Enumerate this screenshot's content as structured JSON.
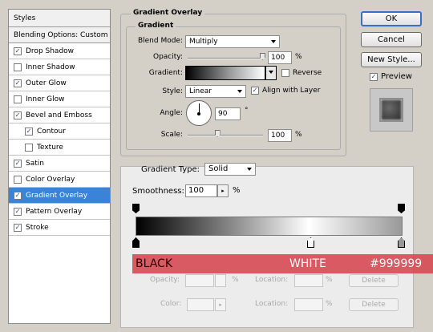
{
  "styles_panel": {
    "header": "Styles",
    "blending_options": "Blending Options: Custom",
    "items": [
      {
        "label": "Drop Shadow",
        "checked": true,
        "indent": false,
        "selected": false
      },
      {
        "label": "Inner Shadow",
        "checked": false,
        "indent": false,
        "selected": false
      },
      {
        "label": "Outer Glow",
        "checked": true,
        "indent": false,
        "selected": false
      },
      {
        "label": "Inner Glow",
        "checked": false,
        "indent": false,
        "selected": false
      },
      {
        "label": "Bevel and Emboss",
        "checked": true,
        "indent": false,
        "selected": false
      },
      {
        "label": "Contour",
        "checked": true,
        "indent": true,
        "selected": false
      },
      {
        "label": "Texture",
        "checked": false,
        "indent": true,
        "selected": false
      },
      {
        "label": "Satin",
        "checked": true,
        "indent": false,
        "selected": false
      },
      {
        "label": "Color Overlay",
        "checked": false,
        "indent": false,
        "selected": false
      },
      {
        "label": "Gradient Overlay",
        "checked": true,
        "indent": false,
        "selected": true
      },
      {
        "label": "Pattern Overlay",
        "checked": true,
        "indent": false,
        "selected": false
      },
      {
        "label": "Stroke",
        "checked": true,
        "indent": false,
        "selected": false
      }
    ]
  },
  "gradient_overlay": {
    "section_title": "Gradient Overlay",
    "group_title": "Gradient",
    "blend_mode_label": "Blend Mode:",
    "blend_mode_value": "Multiply",
    "opacity_label": "Opacity:",
    "opacity_value": "100",
    "opacity_level": 1.0,
    "percent": "%",
    "gradient_label": "Gradient:",
    "reverse_label": "Reverse",
    "reverse_checked": false,
    "style_label": "Style:",
    "style_value": "Linear",
    "align_label": "Align with Layer",
    "align_checked": true,
    "angle_label": "Angle:",
    "angle_value": "90",
    "degree_symbol": "°",
    "scale_label": "Scale:",
    "scale_value": "100",
    "scale_level": 0.4
  },
  "buttons": {
    "ok": "OK",
    "cancel": "Cancel",
    "new_style": "New Style...",
    "preview_label": "Preview",
    "preview_checked": true
  },
  "gradient_editor": {
    "gradient_type_label": "Gradient Type:",
    "gradient_type_value": "Solid",
    "smoothness_label": "Smoothness:",
    "smoothness_value": "100",
    "percent": "%",
    "stop_labels": [
      "BLACK",
      "WHITE",
      "#999999"
    ],
    "stop_colors": [
      "#000000",
      "#ffffff",
      "#999999"
    ],
    "stops_rows": {
      "opacity_label": "Opacity:",
      "location_label": "Location:",
      "color_label": "Color:",
      "delete_label": "Delete"
    }
  }
}
